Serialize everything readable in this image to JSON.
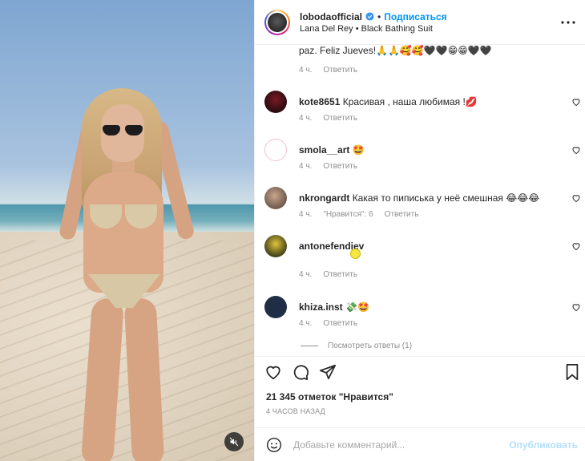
{
  "header": {
    "username": "lobodaofficial",
    "separator": "•",
    "follow_label": "Подписаться",
    "song_artist": "Lana Del Rey",
    "song_separator": "•",
    "song_title": "Black Bathing Suit"
  },
  "caption_tail": {
    "text": "paz. Feliz Jueves!🙏🙏🥰🥰🖤🖤😁😁🖤🖤",
    "time": "4 ч.",
    "reply": "Ответить"
  },
  "comments": [
    {
      "user": "kote8651",
      "text": "Красивая , наша любимая !💋",
      "time": "4 ч.",
      "likes": "",
      "reply": "Ответить"
    },
    {
      "user": "smola__art",
      "text": "🤩",
      "time": "4 ч.",
      "likes": "",
      "reply": "Ответить"
    },
    {
      "user": "nkrongardt",
      "text": "Какая то пиписька у неё смешная 😂😂😂",
      "time": "4 ч.",
      "likes": "\"Нравится\": 6",
      "reply": "Ответить"
    },
    {
      "user": "antonefendiev",
      "text": "",
      "time": "4 ч.",
      "likes": "",
      "reply": "Ответить"
    },
    {
      "user": "khiza.inst",
      "text": "💸🤩",
      "time": "4 ч.",
      "likes": "",
      "reply": "Ответить"
    }
  ],
  "view_replies": "Посмотреть ответы (1)",
  "likes_count": "21 345 отметок \"Нравится\"",
  "posted_ago": "4 ЧАСОВ НАЗАД",
  "add_comment": {
    "placeholder": "Добавьте комментарий...",
    "publish_label": "Опубликовать"
  },
  "colors": {
    "accent": "#0095f6",
    "publish_disabled": "#b2dffc",
    "muted_text": "#8e8e8e",
    "verified": "#3897f0"
  }
}
